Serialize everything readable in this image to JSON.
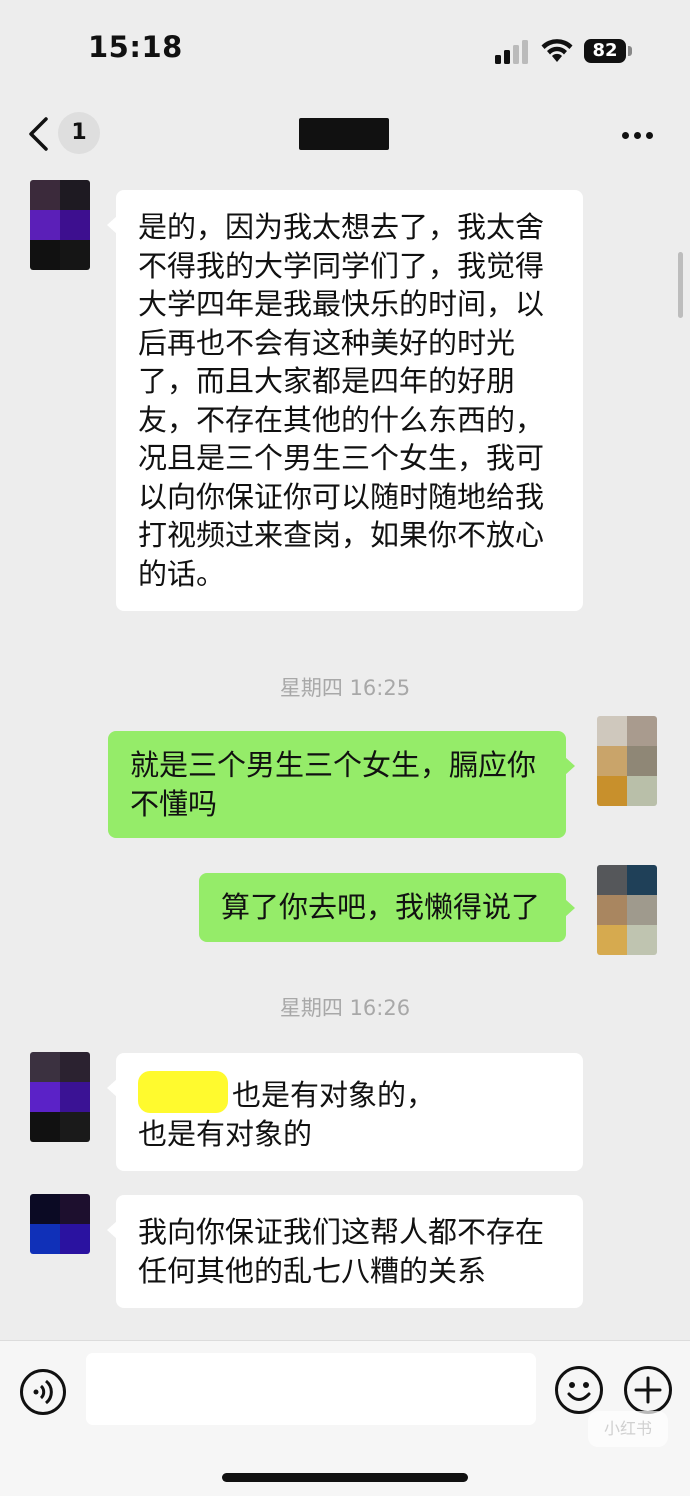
{
  "status_bar": {
    "time": "15:18",
    "battery": "82"
  },
  "nav": {
    "unread_count": "1",
    "title_redacted": true,
    "more_icon": "ellipsis-icon"
  },
  "messages": [
    {
      "sender": "contact",
      "text": "是的，因为我太想去了，我太舍不得我的大学同学们了，我觉得大学四年是我最快乐的时间，以后再也不会有这种美好的时光了，而且大家都是四年的好朋友，不存在其他的什么东西的，况且是三个男生三个女生，我可以向你保证你可以随时随地给我打视频过来查岗，如果你不放心的话。"
    },
    {
      "type": "timestamp",
      "text": "星期四 16:25"
    },
    {
      "sender": "me",
      "text": "就是三个男生三个女生，膈应你不懂吗"
    },
    {
      "sender": "me",
      "text": "算了你去吧，我懒得说了"
    },
    {
      "type": "timestamp",
      "text": "星期四 16:26"
    },
    {
      "sender": "contact",
      "text_part1": "也是有对象的，",
      "text_part2": "也是有对象的",
      "redacted_names": true
    },
    {
      "sender": "contact",
      "text": "我向你保证我们这帮人都不存在任何其他的乱七八糟的关系"
    }
  ],
  "input_bar": {
    "placeholder": "",
    "watermark": "小红书"
  },
  "colors": {
    "background": "#ededed",
    "incoming_bubble": "#ffffff",
    "outgoing_bubble": "#95ec69",
    "timestamp_text": "#a8a8a8",
    "censor_yellow": "#fffa2e"
  }
}
